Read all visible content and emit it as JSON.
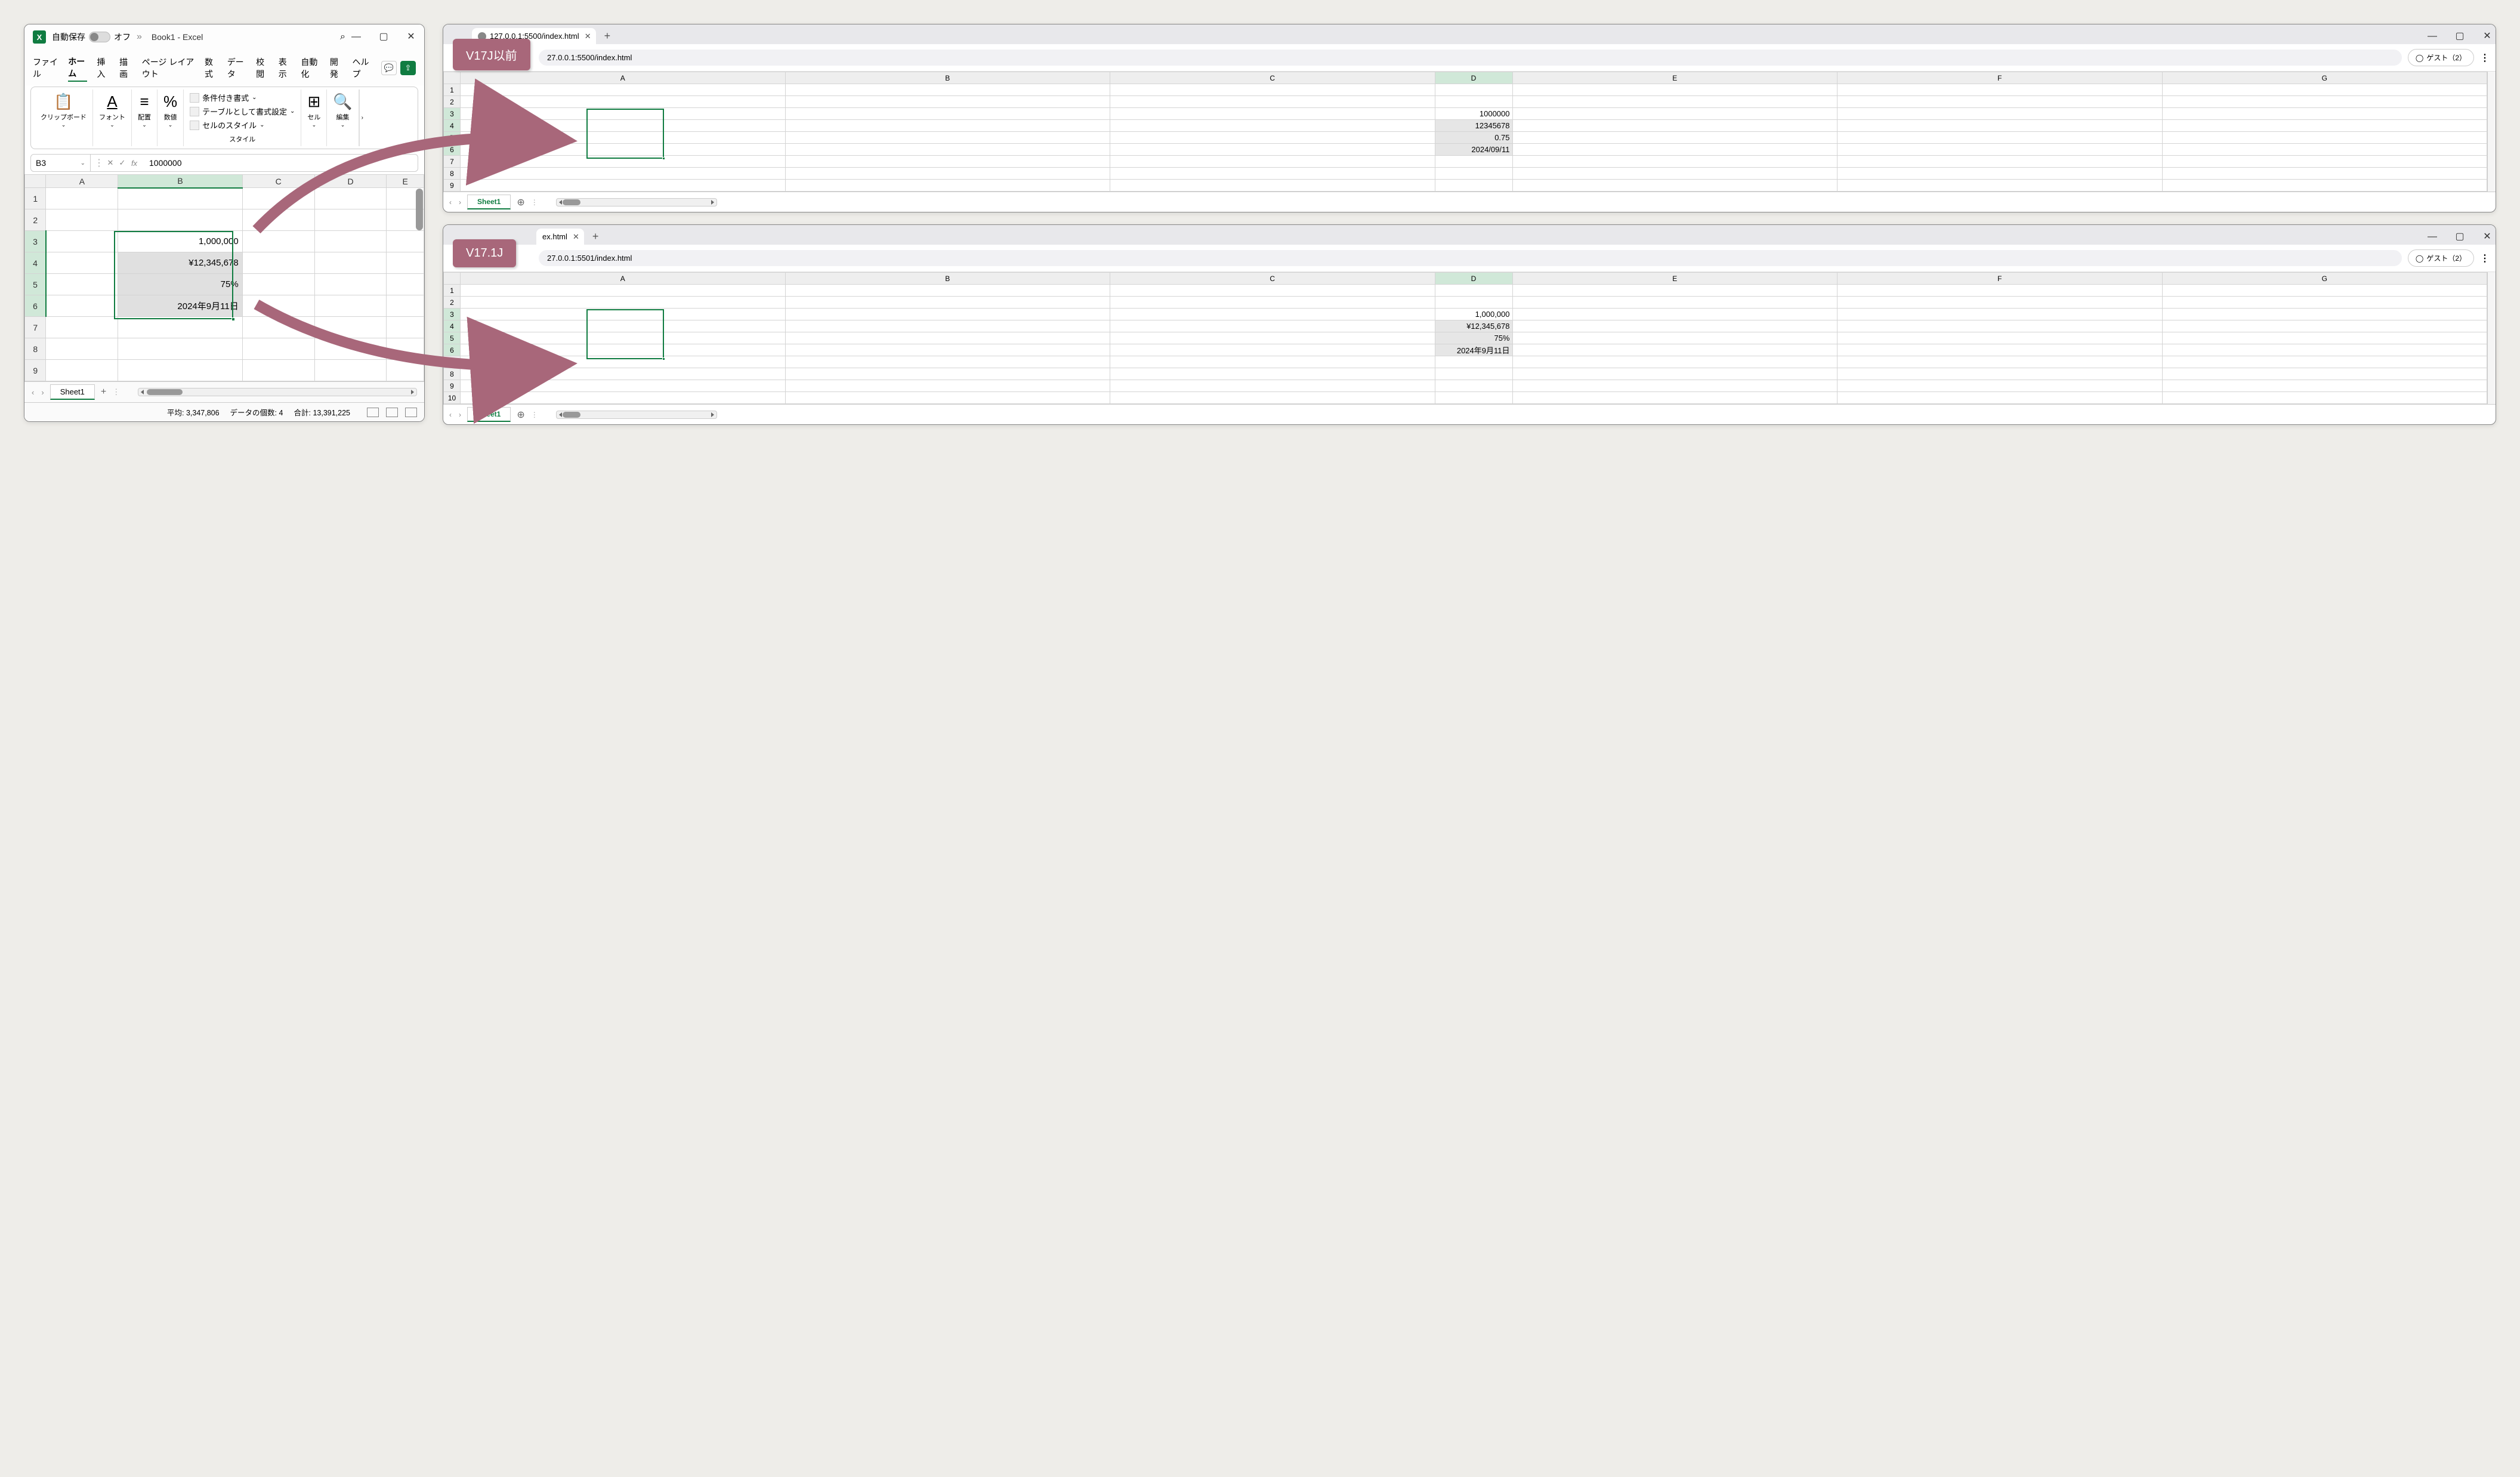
{
  "excel": {
    "autosave_label": "自動保存",
    "autosave_state": "オフ",
    "title": "Book1 - Excel",
    "menu": [
      "ファイル",
      "ホーム",
      "挿入",
      "描画",
      "ページ レイアウト",
      "数式",
      "データ",
      "校閲",
      "表示",
      "自動化",
      "開発",
      "ヘルプ"
    ],
    "active_menu": "ホーム",
    "ribbon": {
      "clipboard": "クリップボード",
      "font": "フォント",
      "alignment": "配置",
      "number": "数値",
      "cond_format": "条件付き書式",
      "table_format": "テーブルとして書式設定",
      "cell_styles": "セルのスタイル",
      "styles": "スタイル",
      "cells": "セル",
      "editing": "編集"
    },
    "namebox": "B3",
    "formula": "1000000",
    "cols": [
      "A",
      "B",
      "C",
      "D",
      "E"
    ],
    "rows": [
      "1",
      "2",
      "3",
      "4",
      "5",
      "6",
      "7",
      "8",
      "9"
    ],
    "sel_col": "B",
    "sel_rows": [
      "3",
      "4",
      "5",
      "6"
    ],
    "cells": {
      "B3": "1,000,000",
      "B4": "¥12,345,678",
      "B5": "75%",
      "B6": "2024年9月11日"
    },
    "sheet": "Sheet1",
    "status": {
      "avg_label": "平均:",
      "avg": "3,347,806",
      "count_label": "データの個数:",
      "count": "4",
      "sum_label": "合計:",
      "sum": "13,391,225"
    }
  },
  "badges": {
    "v17_prev": "V17J以前",
    "v171": "V17.1J"
  },
  "browser_top": {
    "tab_title": "127.0.0.1:5500/index.html",
    "url": "27.0.0.1:5500/index.html",
    "guest": "ゲスト（2）",
    "cols": [
      "A",
      "B",
      "C",
      "D",
      "E",
      "F",
      "G"
    ],
    "rows": [
      "1",
      "2",
      "3",
      "4",
      "5",
      "6",
      "7",
      "8",
      "9"
    ],
    "cells": {
      "D3": "1000000",
      "D4": "12345678",
      "D5": "0.75",
      "D6": "2024/09/11"
    },
    "sheet": "Sheet1"
  },
  "browser_bottom": {
    "tab_title": "ex.html",
    "url": "27.0.0.1:5501/index.html",
    "guest": "ゲスト（2）",
    "cols": [
      "A",
      "B",
      "C",
      "D",
      "E",
      "F",
      "G"
    ],
    "rows": [
      "1",
      "2",
      "3",
      "4",
      "5",
      "6",
      "7",
      "8",
      "9",
      "10"
    ],
    "cells": {
      "D3": "1,000,000",
      "D4": "¥12,345,678",
      "D5": "75%",
      "D6": "2024年9月11日"
    },
    "sheet": "Sheet1"
  }
}
